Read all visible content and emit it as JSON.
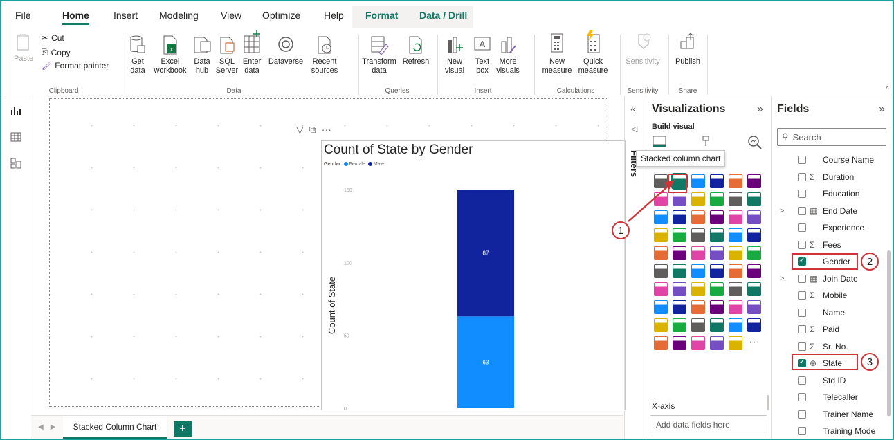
{
  "menu": {
    "tabs": [
      "File",
      "Home",
      "Insert",
      "Modeling",
      "View",
      "Optimize",
      "Help",
      "Format",
      "Data / Drill"
    ],
    "active": "Home"
  },
  "ribbon": {
    "clipboard": {
      "paste": "Paste",
      "cut": "Cut",
      "copy": "Copy",
      "format_painter": "Format painter",
      "group": "Clipboard"
    },
    "data": {
      "get_data": "Get data",
      "excel_workbook": "Excel workbook",
      "data_hub": "Data hub",
      "sql_server": "SQL Server",
      "enter_data": "Enter data",
      "dataverse": "Dataverse",
      "recent_sources": "Recent sources",
      "group": "Data"
    },
    "queries": {
      "transform_data": "Transform data",
      "refresh": "Refresh",
      "group": "Queries"
    },
    "insert": {
      "new_visual": "New visual",
      "text_box": "Text box",
      "more_visuals": "More visuals",
      "group": "Insert"
    },
    "calculations": {
      "new_measure": "New measure",
      "quick_measure": "Quick measure",
      "group": "Calculations"
    },
    "sensitivity": {
      "sensitivity": "Sensitivity",
      "group": "Sensitivity"
    },
    "share": {
      "publish": "Publish",
      "group": "Share"
    }
  },
  "chart_data": {
    "type": "bar",
    "stacked": true,
    "title": "Count of State by Gender",
    "legend_title": "Gender",
    "legend_placement": "top-left",
    "ylabel": "Count of State",
    "xlabel": "",
    "ylim": [
      0,
      150
    ],
    "yticks": [
      0,
      50,
      100,
      150
    ],
    "categories": [
      ""
    ],
    "series": [
      {
        "name": "Female",
        "color": "#118dff",
        "values": [
          63
        ]
      },
      {
        "name": "Male",
        "color": "#12239e",
        "values": [
          87
        ]
      }
    ]
  },
  "page_tab": {
    "name": "Stacked Column Chart",
    "add": "+"
  },
  "filters": {
    "label": "Filters"
  },
  "visualizations": {
    "title": "Visualizations",
    "build_visual": "Build visual",
    "tooltip": "Stacked column chart",
    "xaxis_label": "X-axis",
    "xaxis_placeholder": "Add data fields here"
  },
  "fields": {
    "title": "Fields",
    "search_placeholder": "Search",
    "items": [
      {
        "name": "Course Name",
        "checked": false,
        "type": "",
        "expand": ""
      },
      {
        "name": "Duration",
        "checked": false,
        "type": "Σ",
        "expand": ""
      },
      {
        "name": "Education",
        "checked": false,
        "type": "",
        "expand": ""
      },
      {
        "name": "End Date",
        "checked": false,
        "type": "cal",
        "expand": ">"
      },
      {
        "name": "Experience",
        "checked": false,
        "type": "",
        "expand": ""
      },
      {
        "name": "Fees",
        "checked": false,
        "type": "Σ",
        "expand": ""
      },
      {
        "name": "Gender",
        "checked": true,
        "type": "",
        "expand": ""
      },
      {
        "name": "Join Date",
        "checked": false,
        "type": "cal",
        "expand": ">"
      },
      {
        "name": "Mobile",
        "checked": false,
        "type": "Σ",
        "expand": ""
      },
      {
        "name": "Name",
        "checked": false,
        "type": "",
        "expand": ""
      },
      {
        "name": "Paid",
        "checked": false,
        "type": "Σ",
        "expand": ""
      },
      {
        "name": "Sr. No.",
        "checked": false,
        "type": "Σ",
        "expand": ""
      },
      {
        "name": "State",
        "checked": true,
        "type": "globe",
        "expand": ""
      },
      {
        "name": "Std ID",
        "checked": false,
        "type": "",
        "expand": ""
      },
      {
        "name": "Telecaller",
        "checked": false,
        "type": "",
        "expand": ""
      },
      {
        "name": "Trainer Name",
        "checked": false,
        "type": "",
        "expand": ""
      },
      {
        "name": "Training Mode",
        "checked": false,
        "type": "",
        "expand": ""
      }
    ]
  },
  "annotations": [
    "1",
    "2",
    "3"
  ]
}
